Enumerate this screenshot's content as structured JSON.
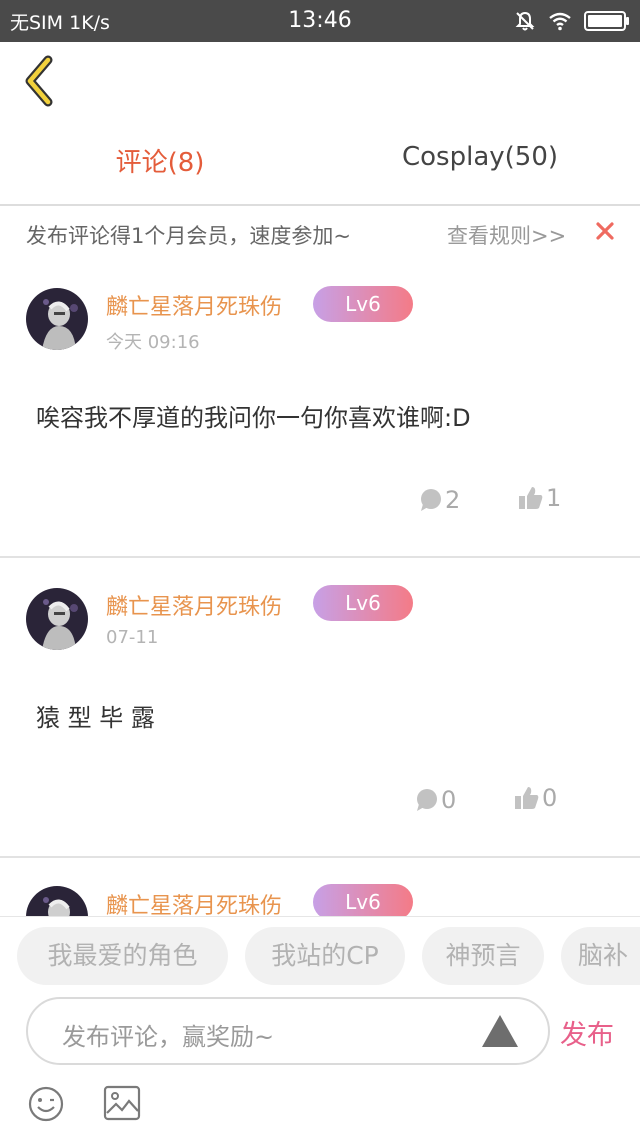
{
  "status_bar": {
    "carrier": "无SIM",
    "speed": "1K/s",
    "time": "13:46",
    "icons": [
      "mute-bell-icon",
      "wifi-icon",
      "battery-icon"
    ]
  },
  "nav": {
    "back_icon": "chevron-left-icon"
  },
  "tabs": {
    "comments": "评论(8)",
    "cosplay": "Cosplay(50)",
    "active": "comments"
  },
  "promo": {
    "text": "发布评论得1个月会员，速度参加~",
    "rules_link": "查看规则>>",
    "close_icon": "close-icon"
  },
  "comments": [
    {
      "username": "麟亡星落月死珠伤",
      "level": "Lv6",
      "time": "今天 09:16",
      "text": "唉容我不厚道的我问你一句你喜欢谁啊:D",
      "reply_count": "2",
      "like_count": "1"
    },
    {
      "username": "麟亡星落月死珠伤",
      "level": "Lv6",
      "time": "07-11",
      "text": "猿 型 毕 露",
      "reply_count": "0",
      "like_count": "0"
    },
    {
      "username": "麟亡星落月死珠伤",
      "level": "Lv6"
    }
  ],
  "quick_tags": [
    "我最爱的角色",
    "我站的CP",
    "神预言",
    "脑补"
  ],
  "composer": {
    "placeholder": "发布评论，赢奖励~",
    "publish_label": "发布",
    "emoji_icon": "emoji-icon",
    "image_icon": "image-icon"
  },
  "colors": {
    "accent_orange": "#e45c3a",
    "username": "#e8944e",
    "publish_pink": "#e8608a",
    "level_gradient_start": "#c7a0e6",
    "level_gradient_end": "#f47b87",
    "status_bar": "#4a4a4a"
  }
}
